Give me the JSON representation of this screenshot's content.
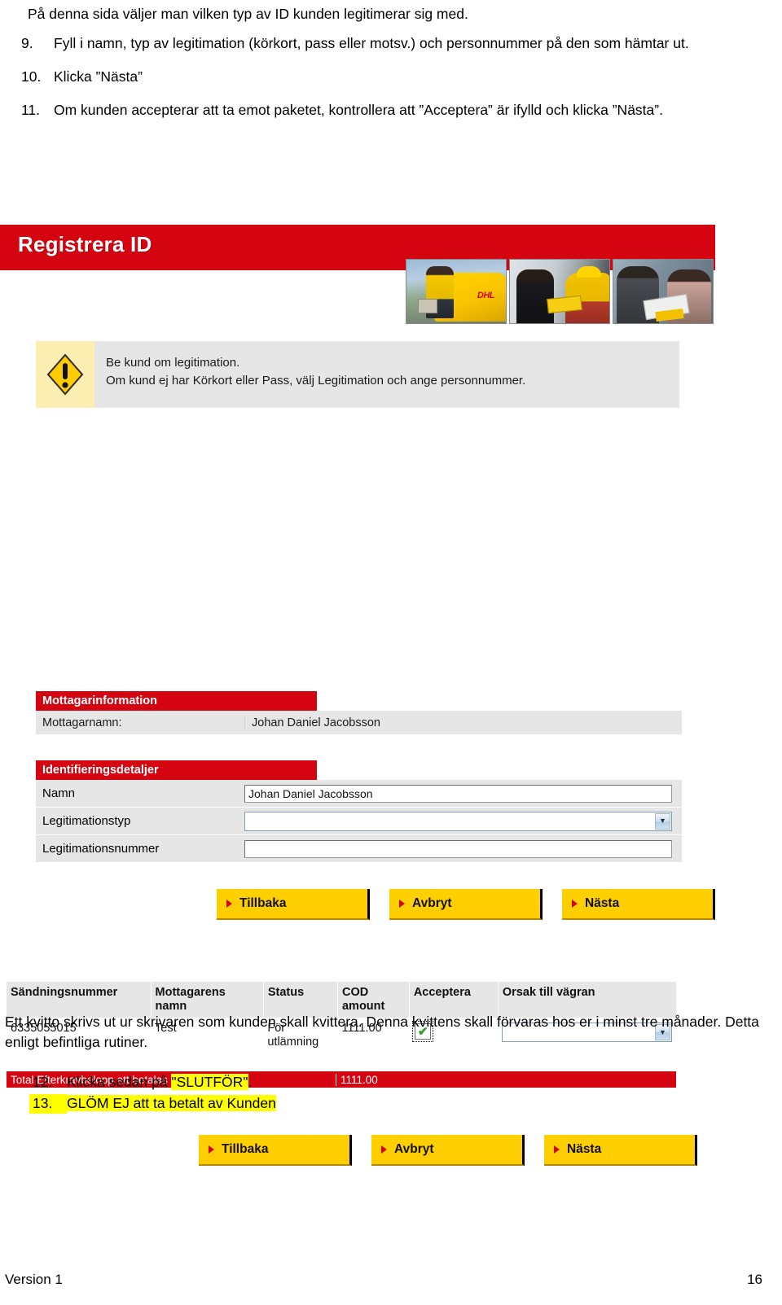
{
  "doc": {
    "intro": "På denna sida väljer man vilken typ av ID kunden legitimerar sig med.",
    "steps": [
      {
        "num": "9.",
        "text": "Fyll i namn, typ av legitimation (körkort, pass eller motsv.) och personnummer på den som hämtar ut."
      },
      {
        "num": "10.",
        "text": "Klicka ”Nästa”"
      },
      {
        "num": "11.",
        "text": "Om kunden accepterar att ta emot paketet, kontrollera att ”Acceptera” är ifylld och klicka ”Nästa”."
      }
    ],
    "outro": "Ett kvitto skrivs ut ur skrivaren som kunden skall kvittera. Denna kvittens skall förvaras hos er i minst tre månader. Detta enligt befintliga rutiner.",
    "steps2": [
      {
        "num": "12.",
        "pre": "Klicka sedan på ",
        "highlight": "\"SLUTFÖR\"",
        "post": "."
      },
      {
        "num": "13.",
        "pre": "",
        "highlight": "GLÖM EJ att ta betalt av Kunden",
        "post": ""
      }
    ],
    "footer_left": "Version 1",
    "footer_right": "16"
  },
  "app": {
    "banner_title": "Registrera ID",
    "warning": {
      "line1": "Be kund om legitimation.",
      "line2": "Om kund ej har Körkort eller Pass, välj Legitimation och ange personnummer."
    },
    "recipient": {
      "section_title": "Mottagarinformation",
      "label": "Mottagarnamn:",
      "value": "Johan Daniel Jacobsson"
    },
    "identification": {
      "section_title": "Identifieringsdetaljer",
      "fields": [
        {
          "label": "Namn",
          "value": "Johan Daniel Jacobsson",
          "type": "text"
        },
        {
          "label": "Legitimationstyp",
          "value": "",
          "type": "select"
        },
        {
          "label": "Legitimationsnummer",
          "value": "",
          "type": "text"
        }
      ]
    },
    "buttons": [
      {
        "label": "Tillbaka"
      },
      {
        "label": "Avbryt"
      },
      {
        "label": "Nästa"
      }
    ],
    "table": {
      "headers": [
        "Sändningsnummer",
        "Mottagarens namn",
        "Status",
        "COD amount",
        "Acceptera",
        "Orsak till vägran"
      ],
      "rows": [
        {
          "shipment": "6335055015",
          "recipient": "Test",
          "status": "För utlämning",
          "cod": "1111.00",
          "accept_checked": true,
          "reason": ""
        }
      ],
      "total_label": "Total Efterkravbelopp att betalas av kunden:",
      "total_value": "1111.00"
    },
    "colors": {
      "brand_red": "#d40511",
      "brand_yellow": "#ffcc00",
      "panel_gray": "#e6e6e6",
      "warning_yellow": "#fbeeb0",
      "highlight": "#ffff00"
    }
  }
}
